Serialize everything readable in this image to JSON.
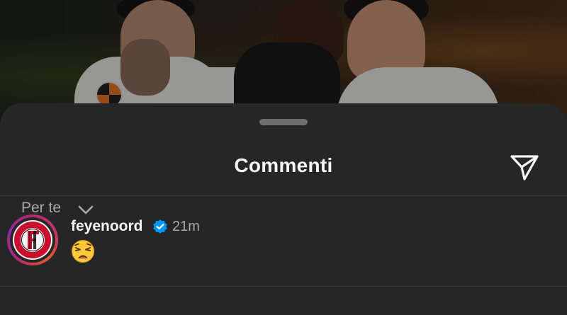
{
  "sheet": {
    "title": "Commenti"
  },
  "comment": {
    "username": "feyenoord",
    "time": "21m",
    "text_emoji": "weary-face-emoji",
    "verified": true,
    "avatar_logo_text": "FEYENOORD ROTTERDAM"
  },
  "filter": {
    "label": "Per te"
  },
  "icons": {
    "share": "send-paper-plane-icon",
    "verified": "verified-badge-icon",
    "filter": "chevron-down-icon"
  },
  "colors": {
    "background": "#262626",
    "text_primary": "#f5f5f5",
    "text_secondary": "#a8a8a8",
    "verified_blue": "#0095f6",
    "feyenoord_red": "#c8102e"
  }
}
